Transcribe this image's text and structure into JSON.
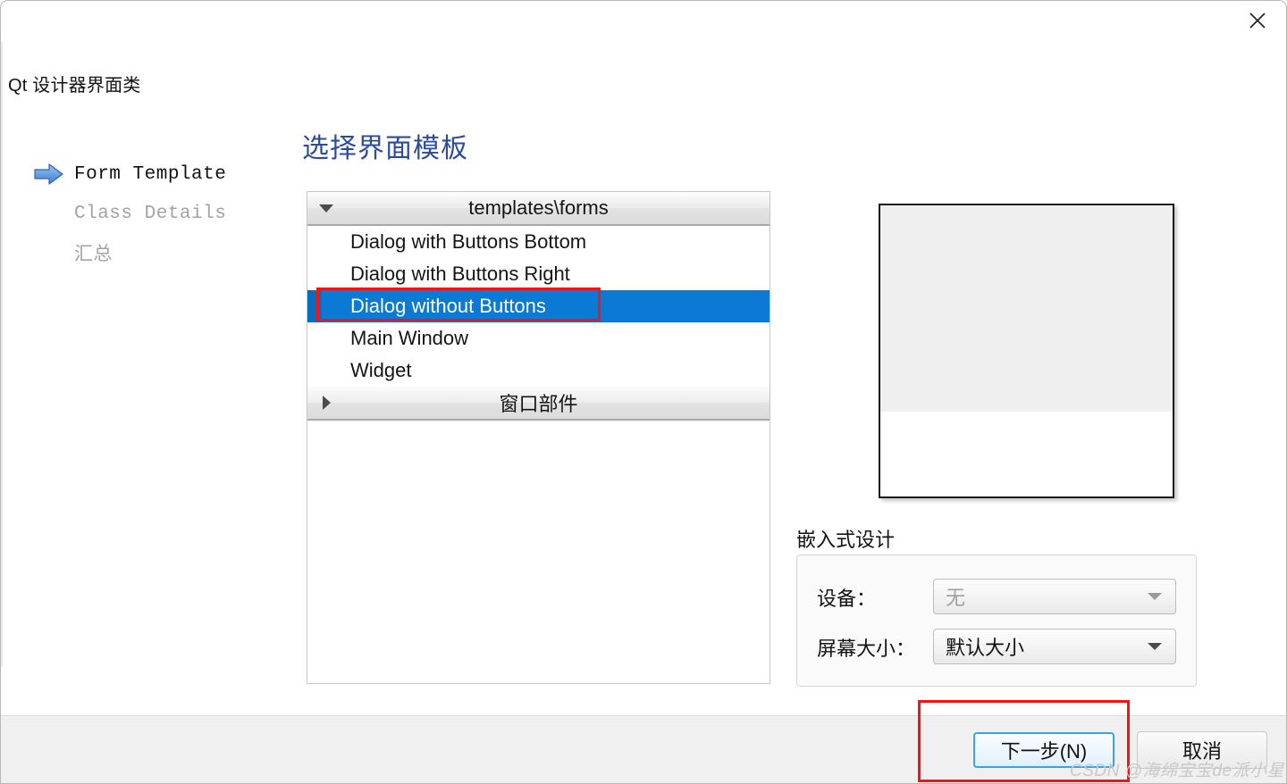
{
  "window": {
    "app_title": "Qt 设计器界面类",
    "close_icon": "close-icon"
  },
  "steps": [
    {
      "label": "Form Template",
      "state": "active",
      "marker": "arrow-right-icon"
    },
    {
      "label": "Class Details",
      "state": "inactive",
      "marker": ""
    },
    {
      "label": "汇总",
      "state": "inactive",
      "marker": ""
    }
  ],
  "main": {
    "page_title": "选择界面模板"
  },
  "tree": {
    "groups": [
      {
        "label": "templates\\forms",
        "expanded": true,
        "twisty_icon": "triangle-down-icon",
        "items": [
          {
            "label": "Dialog with Buttons Bottom",
            "selected": false
          },
          {
            "label": "Dialog with Buttons Right",
            "selected": false
          },
          {
            "label": "Dialog without Buttons",
            "selected": true
          },
          {
            "label": "Main Window",
            "selected": false
          },
          {
            "label": "Widget",
            "selected": false
          }
        ]
      },
      {
        "label": "窗口部件",
        "expanded": false,
        "twisty_icon": "triangle-right-icon",
        "items": []
      }
    ]
  },
  "embedded": {
    "heading": "嵌入式设计",
    "device_label": "设备：",
    "device_value": "无",
    "device_enabled": false,
    "screen_label": "屏幕大小：",
    "screen_value": "默认大小",
    "screen_enabled": true,
    "dropdown_icon": "triangle-down-icon"
  },
  "footer": {
    "next_label": "下一步(N)",
    "cancel_label": "取消"
  },
  "watermark": {
    "text": "CSDN @海绵宝宝de派小星"
  },
  "colors": {
    "selection_blue": "#0b7ad4",
    "heading_blue": "#2b4c9b",
    "annotation_red": "#fb1111",
    "focus_blue": "#3ca2e8",
    "footer_gray": "#f0f0f0"
  }
}
